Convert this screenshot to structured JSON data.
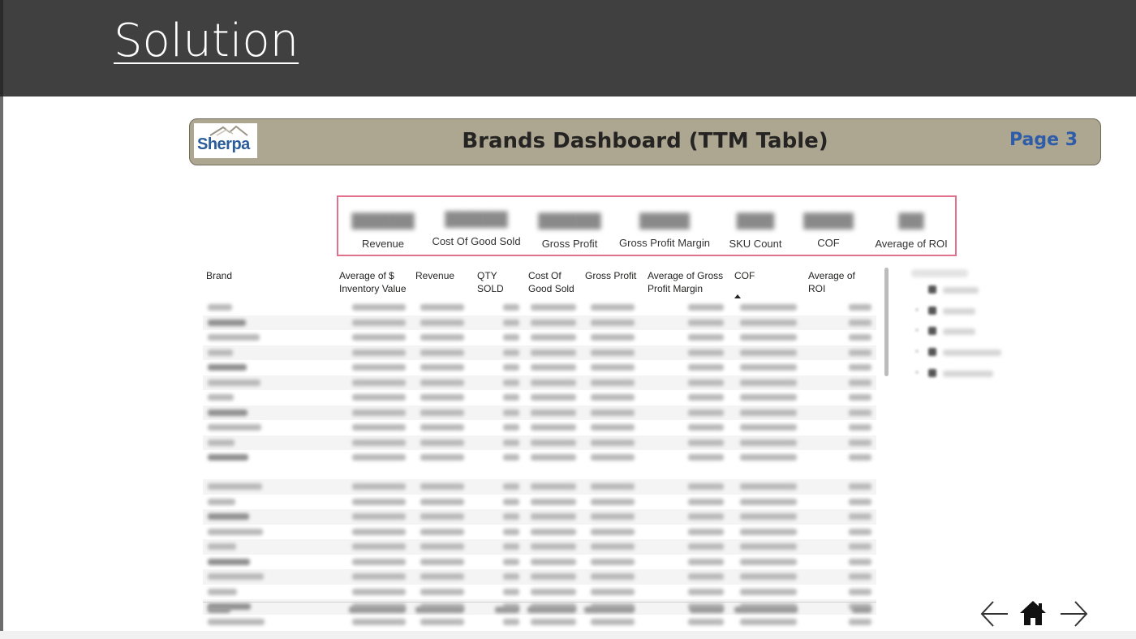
{
  "slide": {
    "title": "Solution"
  },
  "banner": {
    "logo": "Sherpa",
    "title": "Brands Dashboard (TTM Table)",
    "page": "Page 3"
  },
  "kpis": [
    {
      "label": "Revenue"
    },
    {
      "label": "Cost Of Good Sold"
    },
    {
      "label": "Gross Profit"
    },
    {
      "label": "Gross Profit Margin"
    },
    {
      "label": "SKU Count"
    },
    {
      "label": "COF"
    },
    {
      "label": "Average of ROI"
    }
  ],
  "table": {
    "headers": [
      "Brand",
      "Average of $ Inventory Value",
      "Revenue",
      "QTY SOLD",
      "Cost Of Good Sold",
      "Gross Profit",
      "Average of Gross Profit Margin",
      "COF",
      "Average of ROI"
    ],
    "sorted_column": "COF"
  },
  "icons": {
    "prev": "arrow-left-icon",
    "home": "home-icon",
    "next": "arrow-right-icon"
  }
}
